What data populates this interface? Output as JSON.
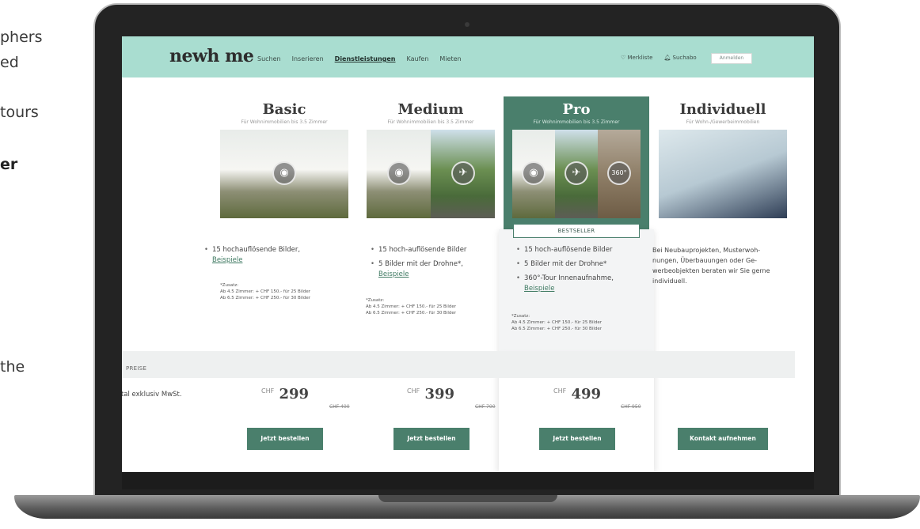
{
  "side_text": {
    "line1": "phers",
    "line2": "ed",
    "line3": "tours",
    "line4": "er",
    "line5": "the"
  },
  "header": {
    "logo": "newh me",
    "nav": [
      "Suchen",
      "Inserieren",
      "Dienstleistungen",
      "Kaufen",
      "Mieten"
    ],
    "merkliste": "Merkliste",
    "suchabo": "Suchabo",
    "anmelden": "Anmelden"
  },
  "plans": [
    {
      "title": "Basic",
      "subtitle": "Für Wohnimmobilien bis 3.5 Zimmer",
      "features": [
        "15 hochauflösende Bilder,"
      ],
      "link": "Beispiele",
      "zusatz": [
        "*Zusatz:",
        "Ab 4.5 Zimmer: + CHF 150.- für 25 Bilder",
        "Ab 6.5 Zimmer: + CHF 250.- für 30 Bilder"
      ],
      "currency": "CHF",
      "price": "299",
      "old_price": "CHF 400",
      "button": "Jetzt bestellen"
    },
    {
      "title": "Medium",
      "subtitle": "Für Wohnimmobilien bis 3.5 Zimmer",
      "features": [
        "15 hoch-auflösende Bilder",
        "5 Bilder mit der Drohne*,"
      ],
      "link": "Beispiele",
      "zusatz": [
        "*Zusatz:",
        "Ab 4.5 Zimmer: + CHF 150.- für 25 Bilder",
        "Ab 6.5 Zimmer: + CHF 250.- für 30 Bilder"
      ],
      "currency": "CHF",
      "price": "399",
      "old_price": "CHF 700",
      "button": "Jetzt bestellen"
    },
    {
      "title": "Pro",
      "subtitle": "Für Wohnimmobilien bis 3.5 Zimmer",
      "badge": "BESTSELLER",
      "features": [
        "15 hoch-auflösende Bilder",
        "5 Bilder mit der Drohne*",
        "360°-Tour Innenaufnahme,"
      ],
      "link": "Beispiele",
      "zusatz": [
        "*Zusatz:",
        "Ab 4.5 Zimmer: + CHF 150.- für 25 Bilder",
        "Ab 6.5 Zimmer: + CHF 250.- für 30 Bilder"
      ],
      "currency": "CHF",
      "price": "499",
      "old_price": "CHF 950",
      "button": "Jetzt bestellen"
    },
    {
      "title": "Individuell",
      "subtitle": "Für Wohn-/Gewerbeimmobilien",
      "text": "Bei Neubauprojekten, Musterwoh-nungen, Überbauungen oder Ge-werbeobjekten beraten wir Sie gerne individuell.",
      "button": "Kontakt aufnehmen"
    }
  ],
  "preise": "PREISE",
  "total_label": "Total exklusiv MwSt.",
  "icons": {
    "camera": "camera-icon",
    "drone": "drone-icon",
    "tour": "360°"
  },
  "colors": {
    "nav_bg": "#a9ddd0",
    "accent": "#4a7f6c"
  }
}
